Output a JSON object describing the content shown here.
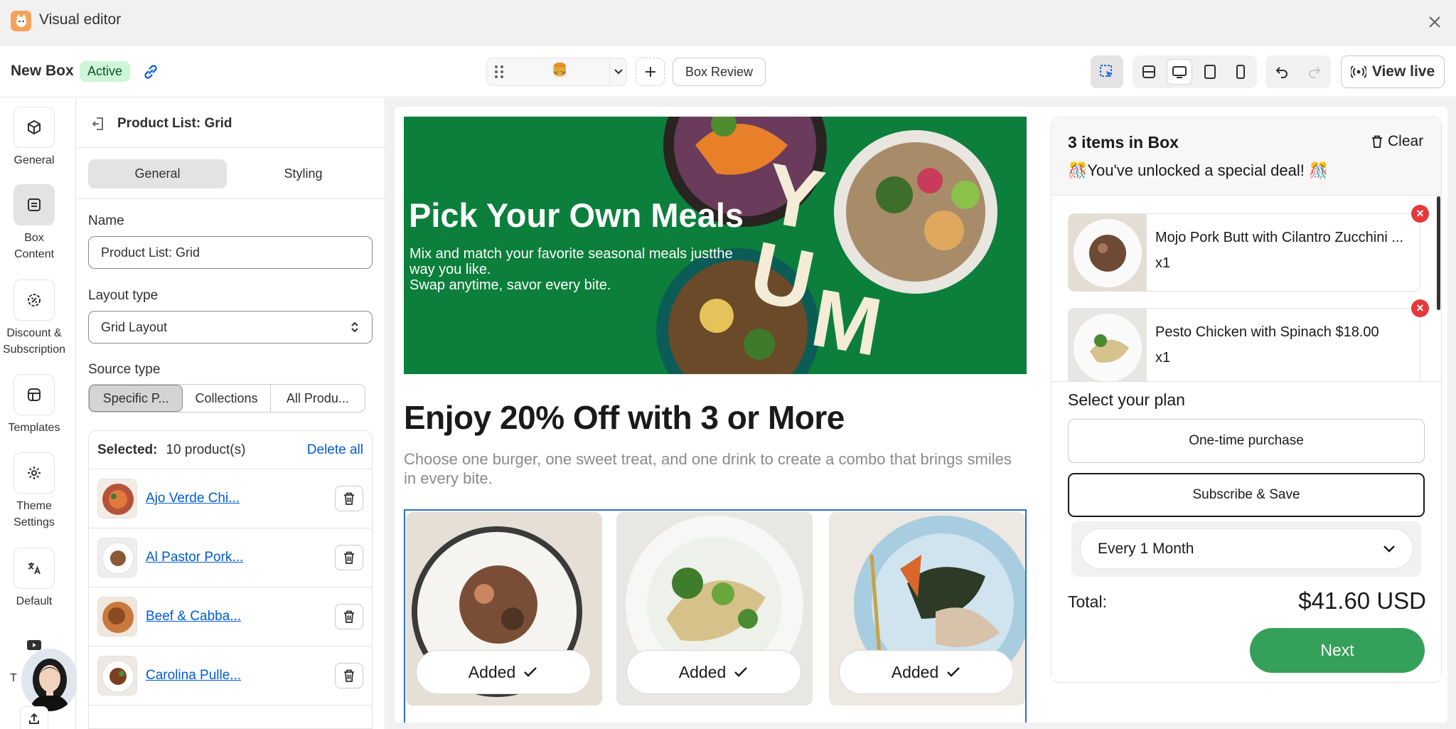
{
  "app": {
    "title": "Visual editor"
  },
  "toolbar": {
    "box_name": "New Box",
    "status": "Active",
    "page_emoji": "🍔",
    "box_review_label": "Box Review",
    "view_live_label": "View live"
  },
  "rail": {
    "items": [
      {
        "label": "General",
        "icon": "cube-icon"
      },
      {
        "label": "Box Content",
        "icon": "list-icon"
      },
      {
        "label": "Discount & Subscription",
        "icon": "discount-icon"
      },
      {
        "label": "Templates",
        "icon": "template-icon"
      },
      {
        "label": "Theme Settings",
        "icon": "gear-icon"
      },
      {
        "label": "Default",
        "icon": "translate-icon"
      },
      {
        "label": "T",
        "icon": "video-icon"
      }
    ]
  },
  "panel": {
    "title": "Product List: Grid",
    "tabs": [
      "General",
      "Styling"
    ],
    "name_label": "Name",
    "name_value": "Product List: Grid",
    "layout_label": "Layout type",
    "layout_value": "Grid Layout",
    "source_label": "Source type",
    "source_options": [
      "Specific P...",
      "Collections",
      "All Produ..."
    ],
    "selected_label": "Selected:",
    "selected_count": "10 product(s)",
    "delete_all": "Delete all",
    "products": [
      "Ajo Verde Chi...",
      "Al Pastor Pork...",
      "Beef & Cabba...",
      "Carolina Pulle..."
    ]
  },
  "banner": {
    "title": "Pick Your Own Meals",
    "subtitle_line1": "Mix and match your favorite seasonal meals justthe",
    "subtitle_line2": "way you like.",
    "subtitle_line3": "Swap anytime, savor every bite.",
    "yum_letters": [
      "Y",
      "U",
      "M"
    ]
  },
  "section": {
    "title": "Enjoy 20% Off with 3 or More",
    "subtitle": "Choose one burger, one sweet treat, and one drink to create a combo that brings smiles in every bite."
  },
  "cards": [
    {
      "button": "Added"
    },
    {
      "button": "Added"
    },
    {
      "button": "Added"
    }
  ],
  "box": {
    "count_label": "3 items in Box",
    "clear_label": "Clear",
    "deal": "🎊You've unlocked a special deal! 🎊",
    "items": [
      {
        "name": "Mojo Pork Butt with Cilantro Zucchini ...",
        "qty": "x1"
      },
      {
        "name": "Pesto Chicken with Spinach $18.00",
        "qty": "x1"
      }
    ],
    "plan_label": "Select your plan",
    "plan_one_time": "One-time purchase",
    "plan_subscribe": "Subscribe & Save",
    "frequency": "Every 1 Month",
    "total_label": "Total:",
    "total_value": "$41.60 USD",
    "next_label": "Next"
  },
  "colors": {
    "banner_green": "#0b7f3b",
    "next_green": "#35a05a",
    "link_blue": "#005bd3",
    "badge_green": "#cdf5d6",
    "remove_red": "#e5383b"
  }
}
